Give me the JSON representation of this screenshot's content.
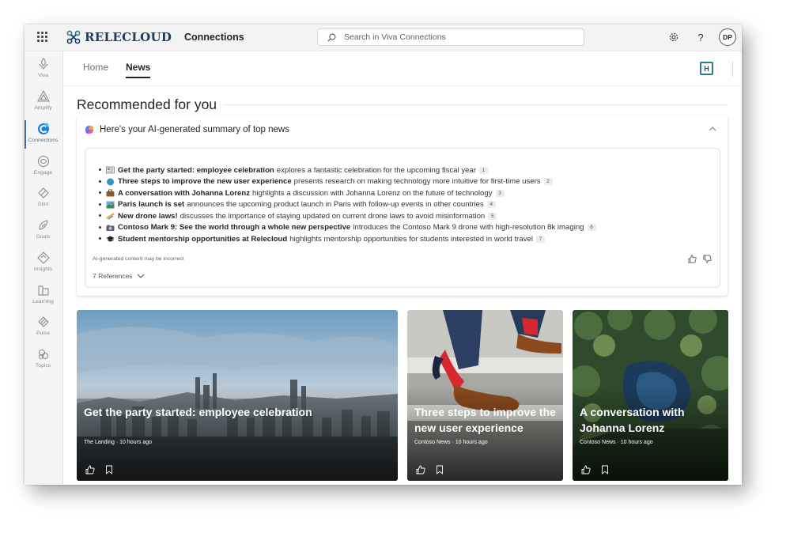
{
  "topbar": {
    "brand": "RELECLOUD",
    "app_name": "Connections",
    "search_placeholder": "Search in Viva Connections",
    "avatar_initials": "DP",
    "icons": [
      "waffle-icon",
      "relecloud-logo-icon",
      "search-icon",
      "settings-gear-icon",
      "help-question-icon"
    ]
  },
  "rail": {
    "items": [
      {
        "label": "Viva",
        "icon": "viva-icon"
      },
      {
        "label": "Amplify",
        "icon": "amplify-icon"
      },
      {
        "label": "Connections",
        "icon": "connections-icon",
        "active": true
      },
      {
        "label": "Engage",
        "icon": "engage-icon"
      },
      {
        "label": "Glint",
        "icon": "glint-icon"
      },
      {
        "label": "Goals",
        "icon": "goals-icon"
      },
      {
        "label": "Insights",
        "icon": "insights-icon"
      },
      {
        "label": "Learning",
        "icon": "learning-icon"
      },
      {
        "label": "Pulse",
        "icon": "pulse-icon"
      },
      {
        "label": "Topics",
        "icon": "topics-icon"
      }
    ]
  },
  "subnav": {
    "tabs": [
      {
        "label": "Home",
        "active": false
      },
      {
        "label": "News",
        "active": true
      }
    ],
    "badge_letter": "H"
  },
  "main": {
    "section_title": "Recommended for you",
    "summary": {
      "heading": "Here's your AI-generated summary of top news",
      "items": [
        {
          "emoji": "newspaper-icon",
          "bold": "Get the party started: employee celebration",
          "text": "explores a fantastic celebration for the upcoming fiscal year",
          "ref": "1"
        },
        {
          "emoji": "globe-icon",
          "bold": "Three steps to improve the new user experience",
          "text": "presents research on making technology more intuitive for first-time users",
          "ref": "2"
        },
        {
          "emoji": "briefcase-icon",
          "bold": "A conversation with Johanna Lorenz",
          "text": "highlights a discussion with Johanna Lorenz on the future of technology",
          "ref": "3"
        },
        {
          "emoji": "map-icon",
          "bold": "Paris launch is set",
          "text": "announces the upcoming product launch in Paris with follow-up events in other countries",
          "ref": "4"
        },
        {
          "emoji": "drone-icon",
          "bold": "New drone laws!",
          "text": "discusses the importance of staying updated on current drone laws to avoid misinformation",
          "ref": "5"
        },
        {
          "emoji": "camera-icon",
          "bold": "Contoso Mark 9: See the world through a whole new perspective",
          "text": "introduces the Contoso Mark 9 drone with high-resolution 8k imaging",
          "ref": "6"
        },
        {
          "emoji": "graduation-cap-icon",
          "bold": "Student mentorship opportunities at Relecloud",
          "text": "highlights mentorship opportunities for students interested in world travel",
          "ref": "7"
        }
      ],
      "disclaimer": "AI-generated content may be incorrect",
      "references_label": "7 References"
    },
    "news_cards": [
      {
        "title": "Get the party started: employee celebration",
        "meta": "The Landing · 10 hours ago"
      },
      {
        "title": "Three steps to improve the new user experience",
        "meta": "Contoso News · 10 hours ago"
      },
      {
        "title": "A conversation with Johanna Lorenz",
        "meta": "Contoso News · 10 hours ago"
      }
    ]
  },
  "colors": {
    "brand_navy": "#1d3a62",
    "brand_teal": "#2d7c8c",
    "rail_active": "#3b6ea5"
  }
}
